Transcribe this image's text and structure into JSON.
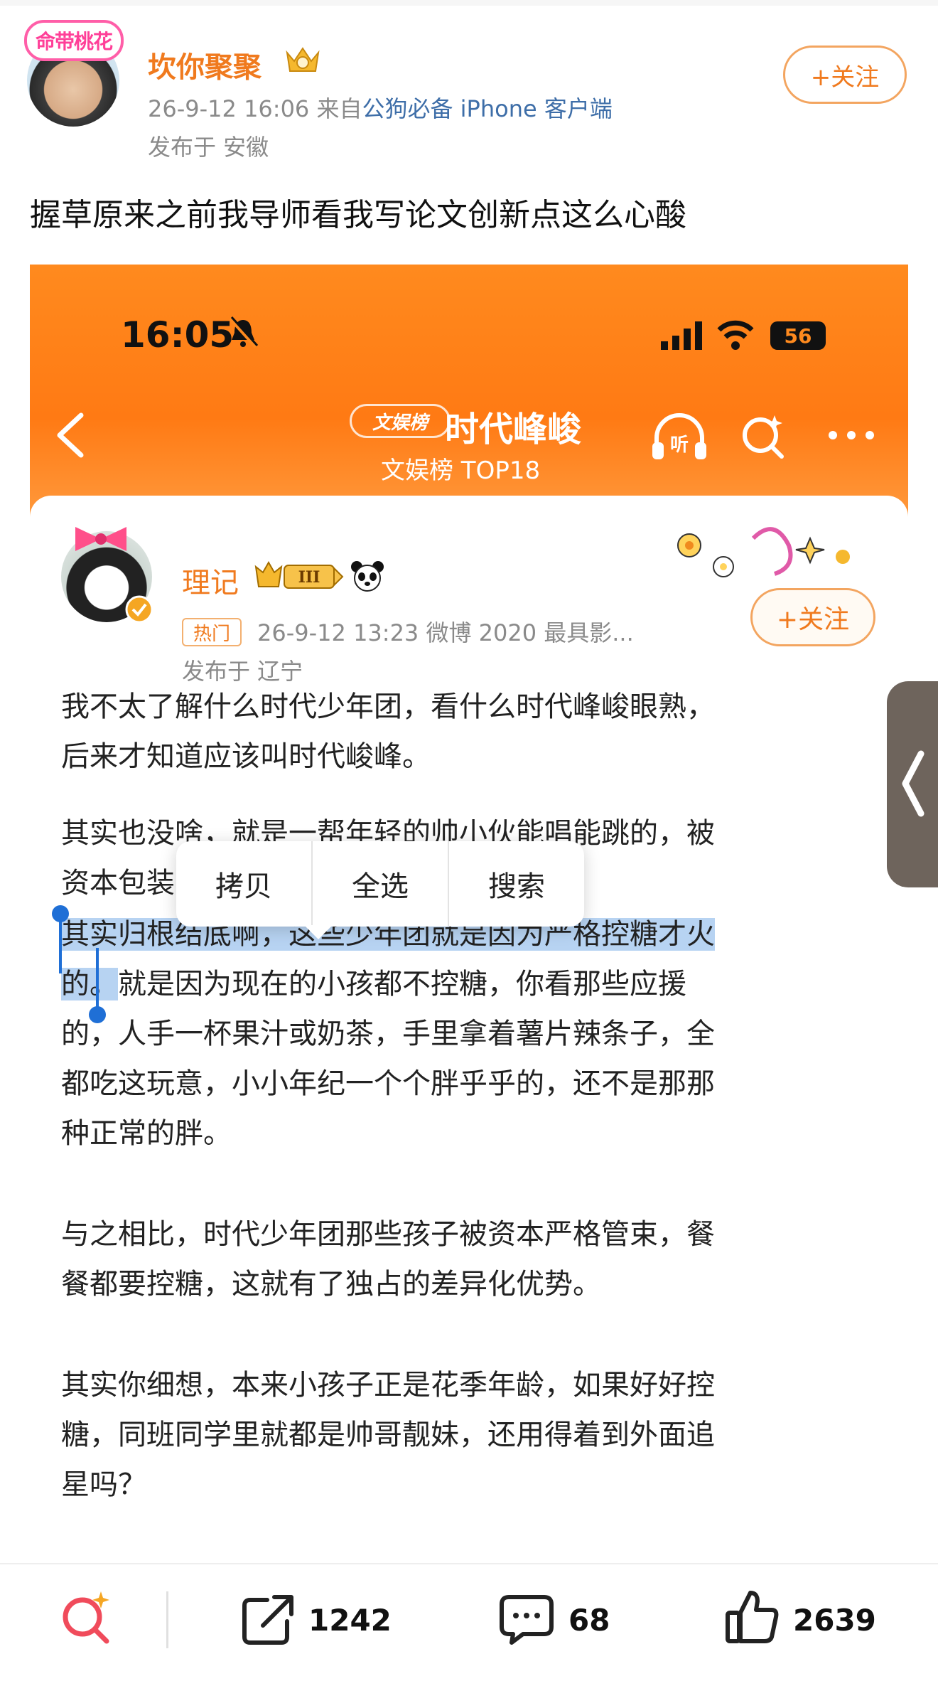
{
  "post": {
    "author": "坎你聚聚",
    "avatar_badge": "命带桃花",
    "time": "26-9-12 16:06",
    "source_prefix": "来自",
    "source": "公狗必备 iPhone 客户端",
    "ip": "发布于 安徽",
    "follow_label": "+关注",
    "text": "握草原来之前我导师看我写论文创新点这么心酸"
  },
  "screenshot": {
    "status_time": "16:05",
    "battery": "56",
    "list_badge": "文娱榜",
    "topic_title": "时代峰峻",
    "topic_sub": "文娱榜 TOP18",
    "inner_author": "理记",
    "level": "III",
    "hot_tag": "热门",
    "inner_meta": "26-9-12 13:23  微博 2020 最具影...",
    "inner_ip": "发布于 辽宁",
    "inner_follow": "+关注",
    "paragraphs": {
      "p1_l1": "我不太了解什么时代少年团，看什么时代峰峻眼熟，",
      "p1_l2": "后来才知道应该叫时代峻峰。",
      "p2_l1": "其实也没啥，就是一帮年轻的帅小伙能唱能跳的，被",
      "p2_l2": "资本包装之后",
      "p3_sel1": "其实归根结底啊，这些少年团就是因为严格控糖才火",
      "p3_sel2": "的。",
      "p3_l2_rest": "就是因为现在的小孩都不控糖，你看那些应援",
      "p3_l3": "的，人手一杯果汁或奶茶，手里拿着薯片辣条子，全",
      "p3_l4": "都吃这玩意，小小年纪一个个胖乎乎的，还不是那那",
      "p3_l5": "种正常的胖。",
      "p4_l1": "与之相比，时代少年团那些孩子被资本严格管束，餐",
      "p4_l2": "餐都要控糖，这就有了独占的差异化优势。",
      "p5_l1": "其实你细想，本来小孩子正是花季年龄，如果好好控",
      "p5_l2": "糖，同班同学里就都是帅哥靓妹，还用得着到外面追",
      "p5_l3": "星吗？"
    },
    "context_menu": [
      "拷贝",
      "全选",
      "搜索"
    ]
  },
  "actions": {
    "repost_count": "1242",
    "comment_count": "68",
    "like_count": "2639"
  },
  "colors": {
    "accent_orange": "#f07a1e",
    "header_orange": "#ff7a14",
    "selection_blue": "#b7d3f2",
    "source_blue": "#3e6ea8"
  }
}
